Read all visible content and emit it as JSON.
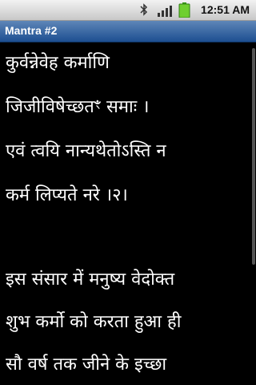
{
  "status_bar": {
    "time": "12:51 AM",
    "icons": [
      "bluetooth-icon",
      "signal-icon",
      "battery-icon"
    ]
  },
  "title_bar": {
    "title": "Mantra #2"
  },
  "mantra": {
    "sanskrit_lines": [
      "कुर्वन्नेवेह कर्माणि",
      "जिजीविषेच्छतꣳ समाः ।",
      "एवं त्वयि नान्यथेतोऽस्ति न",
      "कर्म लिप्यते नरे ।२।"
    ],
    "translation_lines": [
      "इस संसार में मनुष्य वेदोक्त",
      "शुभ कर्मो को करता हुआ ही",
      "सौ वर्ष तक जीने के इच्छा"
    ]
  },
  "colors": {
    "background": "#000000",
    "text": "#ffffff",
    "title_bar": "#2a5a9c"
  }
}
